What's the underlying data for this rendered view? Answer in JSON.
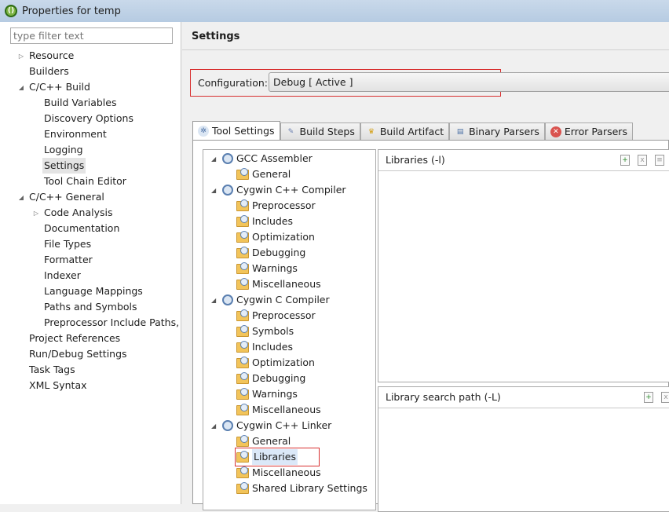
{
  "window": {
    "title": "Properties for temp"
  },
  "filter": {
    "placeholder": "type filter text"
  },
  "nav": [
    {
      "label": "Resource",
      "level": 0,
      "arrow": "collapsed"
    },
    {
      "label": "Builders",
      "level": 0
    },
    {
      "label": "C/C++ Build",
      "level": 0,
      "arrow": "expanded"
    },
    {
      "label": "Build Variables",
      "level": 1
    },
    {
      "label": "Discovery Options",
      "level": 1
    },
    {
      "label": "Environment",
      "level": 1
    },
    {
      "label": "Logging",
      "level": 1
    },
    {
      "label": "Settings",
      "level": 1,
      "selected": true
    },
    {
      "label": "Tool Chain Editor",
      "level": 1
    },
    {
      "label": "C/C++ General",
      "level": 0,
      "arrow": "expanded"
    },
    {
      "label": "Code Analysis",
      "level": 1,
      "arrow": "collapsed"
    },
    {
      "label": "Documentation",
      "level": 1
    },
    {
      "label": "File Types",
      "level": 1
    },
    {
      "label": "Formatter",
      "level": 1
    },
    {
      "label": "Indexer",
      "level": 1
    },
    {
      "label": "Language Mappings",
      "level": 1
    },
    {
      "label": "Paths and Symbols",
      "level": 1
    },
    {
      "label": "Preprocessor Include Paths,",
      "level": 1
    },
    {
      "label": "Project References",
      "level": 0
    },
    {
      "label": "Run/Debug Settings",
      "level": 0
    },
    {
      "label": "Task Tags",
      "level": 0
    },
    {
      "label": "XML Syntax",
      "level": 0
    }
  ],
  "main": {
    "header": "Settings",
    "configuration_label": "Configuration:",
    "configuration_value": "Debug  [ Active ]",
    "tabs": [
      {
        "label": "Tool Settings",
        "icon": "gear-icon",
        "active": true
      },
      {
        "label": "Build Steps",
        "icon": "build-steps-icon"
      },
      {
        "label": "Build Artifact",
        "icon": "trophy-icon"
      },
      {
        "label": "Binary Parsers",
        "icon": "binary-icon"
      },
      {
        "label": "Error Parsers",
        "icon": "error-icon"
      }
    ],
    "tool_tree": [
      {
        "label": "GCC Assembler",
        "type": "tool"
      },
      {
        "label": "General",
        "type": "option"
      },
      {
        "label": "Cygwin C++ Compiler",
        "type": "tool"
      },
      {
        "label": "Preprocessor",
        "type": "option"
      },
      {
        "label": "Includes",
        "type": "option"
      },
      {
        "label": "Optimization",
        "type": "option"
      },
      {
        "label": "Debugging",
        "type": "option"
      },
      {
        "label": "Warnings",
        "type": "option"
      },
      {
        "label": "Miscellaneous",
        "type": "option"
      },
      {
        "label": "Cygwin C Compiler",
        "type": "tool"
      },
      {
        "label": "Preprocessor",
        "type": "option"
      },
      {
        "label": "Symbols",
        "type": "option"
      },
      {
        "label": "Includes",
        "type": "option"
      },
      {
        "label": "Optimization",
        "type": "option"
      },
      {
        "label": "Debugging",
        "type": "option"
      },
      {
        "label": "Warnings",
        "type": "option"
      },
      {
        "label": "Miscellaneous",
        "type": "option"
      },
      {
        "label": "Cygwin C++ Linker",
        "type": "tool"
      },
      {
        "label": "General",
        "type": "option"
      },
      {
        "label": "Libraries",
        "type": "option",
        "selected": true
      },
      {
        "label": "Miscellaneous",
        "type": "option"
      },
      {
        "label": "Shared Library Settings",
        "type": "option"
      }
    ],
    "libraries_title": "Libraries (-l)",
    "library_path_title": "Library search path (-L)"
  }
}
